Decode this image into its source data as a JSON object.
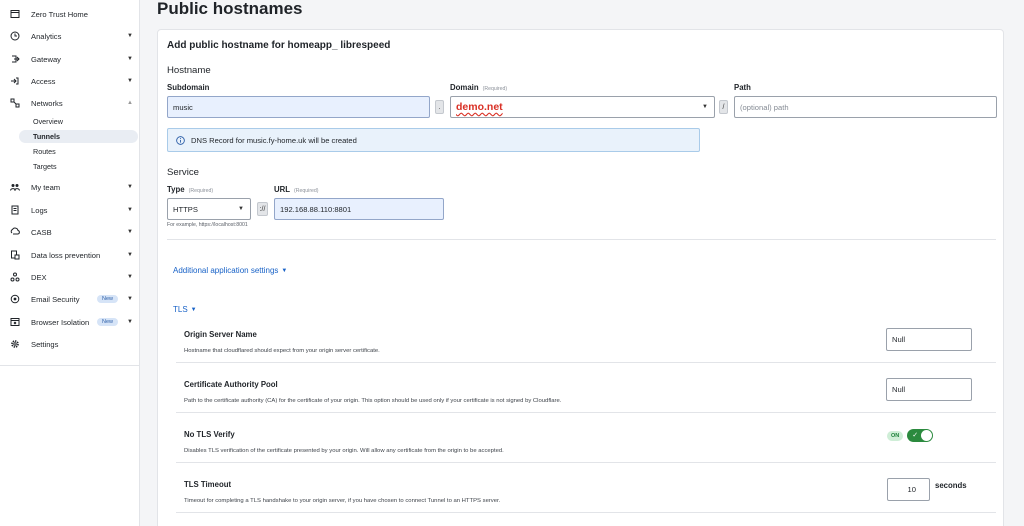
{
  "sidebar": {
    "items": [
      {
        "label": "Zero Trust Home",
        "icon": "calendar-icon",
        "chevron": ""
      },
      {
        "label": "Analytics",
        "icon": "clock-icon",
        "chevron": "▼"
      },
      {
        "label": "Gateway",
        "icon": "gateway-icon",
        "chevron": "▼"
      },
      {
        "label": "Access",
        "icon": "login-icon",
        "chevron": "▼"
      },
      {
        "label": "Networks",
        "icon": "network-icon",
        "chevron": "▲"
      },
      {
        "label": "My team",
        "icon": "team-icon",
        "chevron": "▼"
      },
      {
        "label": "Logs",
        "icon": "logs-icon",
        "chevron": "▼"
      },
      {
        "label": "CASB",
        "icon": "casb-icon",
        "chevron": "▼"
      },
      {
        "label": "Data loss prevention",
        "icon": "dlp-icon",
        "chevron": "▼"
      },
      {
        "label": "DEX",
        "icon": "dex-icon",
        "chevron": "▼"
      },
      {
        "label": "Email Security",
        "icon": "email-security-icon",
        "chevron": "▼",
        "badge": "New"
      },
      {
        "label": "Browser Isolation",
        "icon": "browser-isolation-icon",
        "chevron": "▼",
        "badge": "New"
      },
      {
        "label": "Settings",
        "icon": "gear-icon",
        "chevron": ""
      }
    ],
    "networks_sub": [
      "Overview",
      "Tunnels",
      "Routes",
      "Targets"
    ]
  },
  "page": {
    "title": "Public hostnames",
    "card_title": "Add public hostname for homeapp_ librespeed"
  },
  "hostname": {
    "section": "Hostname",
    "subdomain_label": "Subdomain",
    "subdomain_value": "music",
    "dot": ".",
    "domain_label": "Domain",
    "required": "(Required)",
    "domain_value": "demo.net",
    "slash": "/",
    "path_label": "Path",
    "path_placeholder": "(optional) path",
    "dns_info": "DNS Record for music.fy-home.uk will be created"
  },
  "service": {
    "section": "Service",
    "type_label": "Type",
    "type_value": "HTTPS",
    "url_label": "URL",
    "scheme_sep": "://",
    "url_value": "192.168.88.110:8801",
    "helper": "For example, https://localhost:8001"
  },
  "additional_settings": "Additional application settings",
  "tls": {
    "label": "TLS",
    "rows": [
      {
        "title": "Origin Server Name",
        "desc": "Hostname that cloudflared should expect from your origin server certificate.",
        "value": "Null"
      },
      {
        "title": "Certificate Authority Pool",
        "desc": "Path to the certificate authority (CA) for the certificate of your origin. This option should be used only if your certificate is not signed by Cloudflare.",
        "value": "Null"
      },
      {
        "title": "No TLS Verify",
        "desc": "Disables TLS verification of the certificate presented by your origin. Will allow any certificate from the origin to be accepted.",
        "toggle_label": "ON"
      },
      {
        "title": "TLS Timeout",
        "desc": "Timeout for completing a TLS handshake to your origin server, if you have chosen to connect Tunnel to an HTTPS server.",
        "value": "10",
        "unit": "seconds"
      }
    ]
  },
  "colors": {
    "accent": "#1862c7",
    "toggle_on": "#2b8a3e",
    "error": "#d93025"
  }
}
